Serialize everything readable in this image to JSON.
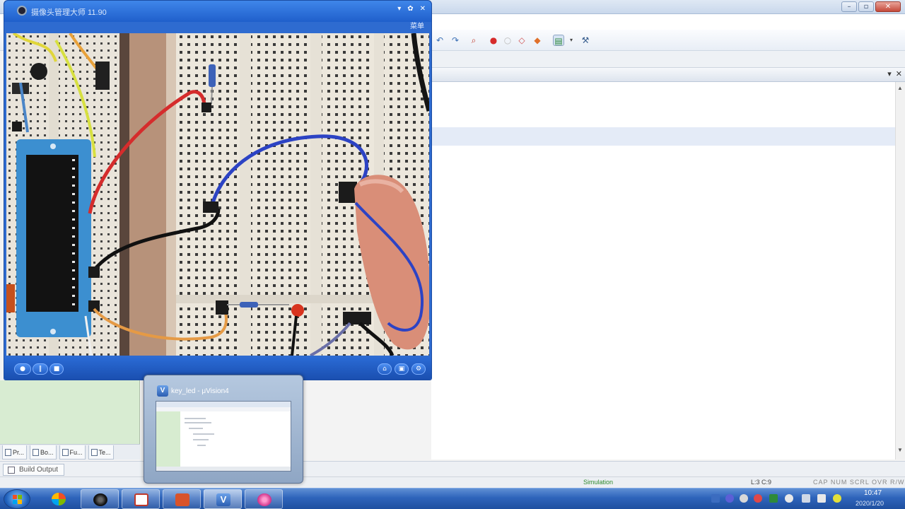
{
  "ide": {
    "sim_status": "Simulation",
    "cursor_pos": "L:3 C:9",
    "kbd_indicators": "CAP NUM SCRL OVR R/W",
    "build_tab": "Build Output",
    "project_tabs": [
      "Pr...",
      "Bo...",
      "Fu...",
      "Te..."
    ],
    "editor_close": "✕",
    "editor_menu": "▾"
  },
  "camera": {
    "title": "摄像头管理大师  11.90",
    "menu": "菜单",
    "btn_min": "▾",
    "btn_max": "✿",
    "btn_close": "✕",
    "ctrl_record": "●",
    "ctrl_pause": "‖",
    "ctrl_stop": "■"
  },
  "preview": {
    "title": "key_led - μVision4",
    "icon": "V"
  },
  "taskbar": {
    "clock_time": "10:47",
    "clock_date": "2020/1/20"
  },
  "colors": {
    "ide_highlight": "#e4ebf7",
    "camera_frame": "#2e6bd0",
    "taskbar": "#2e64bb",
    "project_pane": "#d8ecd2"
  }
}
